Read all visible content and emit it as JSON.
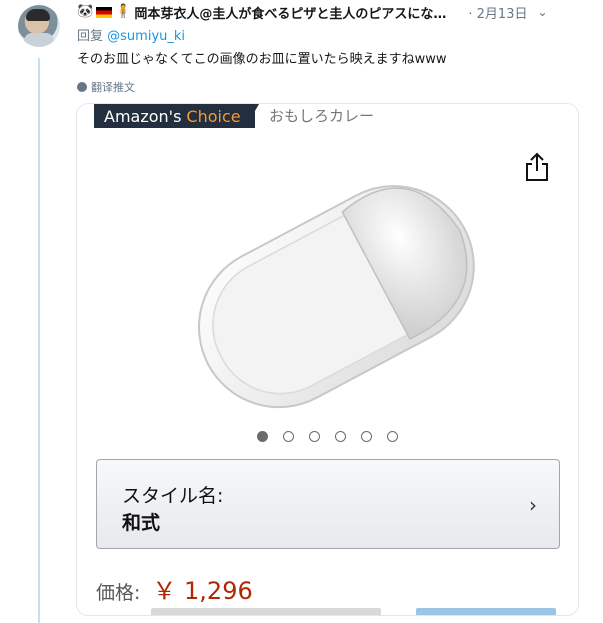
{
  "tweet": {
    "user_name": "岡本芽衣人@圭人が食べるピザと圭人のピアスにな…",
    "header_emojis": [
      "panda-emoji",
      "germany-flag",
      "person-emoji"
    ],
    "date": "· 2月13日",
    "reply_prefix": "回复",
    "reply_mention": "@sumiyu_ki",
    "text": "そのお皿じゃなくてこの画像のお皿に置いたら映えますねwww",
    "translate_label": "翻译推文"
  },
  "card": {
    "badge_main": "Amazon's",
    "badge_accent": "Choice",
    "badge_sub": "おもしろカレー",
    "carousel_total": 6,
    "carousel_active": 0,
    "style_label": "スタイル名:",
    "style_value": "和式",
    "price_label": "価格:",
    "price_value": "￥ 1,296",
    "colors": {
      "badge_bg": "#232f3e",
      "choice_accent": "#f69931",
      "price": "#b12704",
      "mention": "#1b95e0",
      "thread_line": "#c4e0f7"
    }
  }
}
